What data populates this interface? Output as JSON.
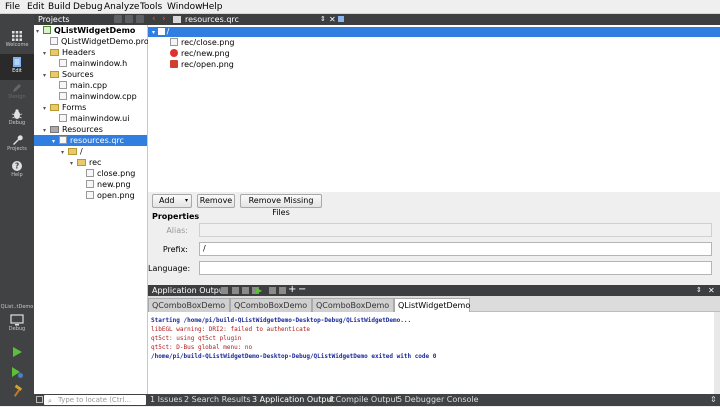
{
  "menu": [
    "File",
    "Edit",
    "Build",
    "Debug",
    "Analyze",
    "Tools",
    "Window",
    "Help"
  ],
  "modes": [
    {
      "label": "Welcome",
      "icon": "grid-icon",
      "state": "normal"
    },
    {
      "label": "Edit",
      "icon": "document-icon",
      "state": "active"
    },
    {
      "label": "Design",
      "icon": "pen-icon",
      "state": "disabled"
    },
    {
      "label": "Debug",
      "icon": "bug-icon",
      "state": "normal"
    },
    {
      "label": "Projects",
      "icon": "wrench-icon",
      "state": "normal"
    },
    {
      "label": "Help",
      "icon": "help-icon",
      "state": "normal"
    }
  ],
  "kit": {
    "project": "QList..tDemo",
    "label": "Debug"
  },
  "projects_header": "Projects",
  "tree": [
    {
      "label": "QListWidgetDemo",
      "depth": 0,
      "kind": "project",
      "expanded": true,
      "bold": true
    },
    {
      "label": "QListWidgetDemo.pro",
      "depth": 1,
      "kind": "file"
    },
    {
      "label": "Headers",
      "depth": 1,
      "kind": "folder",
      "expanded": true
    },
    {
      "label": "mainwindow.h",
      "depth": 2,
      "kind": "file"
    },
    {
      "label": "Sources",
      "depth": 1,
      "kind": "folder",
      "expanded": true
    },
    {
      "label": "main.cpp",
      "depth": 2,
      "kind": "file"
    },
    {
      "label": "mainwindow.cpp",
      "depth": 2,
      "kind": "file"
    },
    {
      "label": "Forms",
      "depth": 1,
      "kind": "folder",
      "expanded": true
    },
    {
      "label": "mainwindow.ui",
      "depth": 2,
      "kind": "file"
    },
    {
      "label": "Resources",
      "depth": 1,
      "kind": "folder",
      "expanded": true
    },
    {
      "label": "resources.qrc",
      "depth": 2,
      "kind": "file",
      "selected": true
    },
    {
      "label": "/",
      "depth": 3,
      "kind": "folder",
      "expanded": true
    },
    {
      "label": "rec",
      "depth": 4,
      "kind": "folder",
      "expanded": true
    },
    {
      "label": "close.png",
      "depth": 5,
      "kind": "file"
    },
    {
      "label": "new.png",
      "depth": 5,
      "kind": "file"
    },
    {
      "label": "open.png",
      "depth": 5,
      "kind": "file"
    }
  ],
  "editor": {
    "file": "resources.qrc"
  },
  "resources": [
    {
      "label": "/",
      "selected": true,
      "icon": "none"
    },
    {
      "label": "rec/close.png",
      "icon": "file-icon"
    },
    {
      "label": "rec/new.png",
      "icon": "no-entry-icon"
    },
    {
      "label": "rec/open.png",
      "icon": "folder-open-icon"
    }
  ],
  "buttons": {
    "add": "Add",
    "remove": "Remove",
    "remove_missing": "Remove Missing Files"
  },
  "properties": {
    "title": "Properties",
    "alias_label": "Alias:",
    "alias_value": "",
    "prefix_label": "Prefix:",
    "prefix_value": "/",
    "language_label": "Language:",
    "language_value": ""
  },
  "output": {
    "header": "Application Output",
    "tabs": [
      "QComboBoxDemo",
      "QComboBoxDemo",
      "QComboBoxDemo",
      "QListWidgetDemo"
    ],
    "lines": [
      {
        "text": "Starting /home/pi/build-QListWidgetDemo-Desktop-Debug/QListWidgetDemo...",
        "color": "#1a2a9a",
        "bold": true
      },
      {
        "text": "libEGL warning: DRI2: failed to authenticate",
        "color": "#b01818"
      },
      {
        "text": "qt5ct: using qt5ct plugin",
        "color": "#b01818"
      },
      {
        "text": "qt5ct: D-Bus global menu: no",
        "color": "#b01818"
      },
      {
        "text": "/home/pi/build-QListWidgetDemo-Desktop-Debug/QListWidgetDemo exited with code 0",
        "color": "#1a2a9a",
        "bold": true
      }
    ]
  },
  "status": {
    "locate_placeholder": "Type to locate (Ctrl...",
    "items": [
      "1 Issues",
      "2 Search Results",
      "3 Application Output",
      "4 Compile Output",
      "5 Debugger Console"
    ]
  }
}
